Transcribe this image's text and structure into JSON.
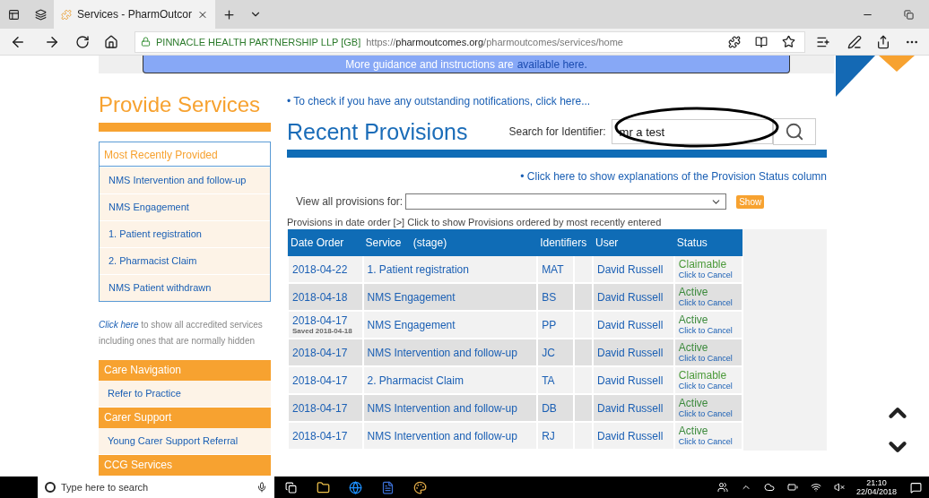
{
  "browser": {
    "tab_title": "Services - PharmOutcor",
    "site_identity": "PINNACLE HEALTH PARTNERSHIP LLP [GB]",
    "url_scheme": "https://",
    "url_host": "pharmoutcomes.org",
    "url_path": "/pharmoutcomes/services/home"
  },
  "banner": {
    "text": "More guidance and instructions are",
    "link": "available here."
  },
  "sidebar": {
    "title": "Provide Services",
    "recent_heading": "Most Recently Provided",
    "recent_items": [
      "NMS Intervention and follow-up",
      "NMS Engagement",
      "1. Patient registration",
      "2. Pharmacist Claim",
      "NMS Patient withdrawn"
    ],
    "show_all_link": "Click here",
    "show_all_text": "to show all accredited services including ones that are normally hidden",
    "sections": [
      {
        "title": "Care Navigation",
        "items": [
          "Refer to Practice"
        ]
      },
      {
        "title": "Carer Support",
        "items": [
          "Young Carer Support Referral"
        ]
      },
      {
        "title": "CCG Services"
      }
    ]
  },
  "main": {
    "notifications_link": "• To check if you have any outstanding notifications, click here...",
    "title": "Recent Provisions",
    "search_label": "Search for Identifier:",
    "search_value": "mr a test",
    "explanations_link": "• Click here to show explanations of the Provision Status column",
    "filter_label": "View all provisions for:",
    "show_button": "Show",
    "order_note": "Provisions in date order [>] Click to show Provisions ordered by most recently entered"
  },
  "table": {
    "columns": [
      "Date Order",
      "Service    (stage)",
      "Identifiers",
      "User",
      "Status"
    ],
    "rows": [
      {
        "date": "2018-04-22",
        "service": "1. Patient registration",
        "identifier": "MAT",
        "user": "David Russell",
        "status": "Claimable",
        "action": "Click to Cancel"
      },
      {
        "date": "2018-04-18",
        "service": "NMS Engagement",
        "identifier": "BS",
        "user": "David Russell",
        "status": "Active",
        "action": "Click to Cancel"
      },
      {
        "date": "2018-04-17",
        "saved": "Saved 2018-04-18",
        "service": "NMS Engagement",
        "identifier": "PP",
        "user": "David Russell",
        "status": "Active",
        "action": "Click to Cancel"
      },
      {
        "date": "2018-04-17",
        "service": "NMS Intervention and follow-up",
        "identifier": "JC",
        "user": "David Russell",
        "status": "Active",
        "action": "Click to Cancel"
      },
      {
        "date": "2018-04-17",
        "service": "2. Pharmacist Claim",
        "identifier": "TA",
        "user": "David Russell",
        "status": "Claimable",
        "action": "Click to Cancel"
      },
      {
        "date": "2018-04-17",
        "service": "NMS Intervention and follow-up",
        "identifier": "DB",
        "user": "David Russell",
        "status": "Active",
        "action": "Click to Cancel"
      },
      {
        "date": "2018-04-17",
        "service": "NMS Intervention and follow-up",
        "identifier": "RJ",
        "user": "David Russell",
        "status": "Active",
        "action": "Click to Cancel"
      }
    ]
  },
  "taskbar": {
    "search_placeholder": "Type here to search",
    "time": "21:10",
    "date": "22/04/2018"
  }
}
